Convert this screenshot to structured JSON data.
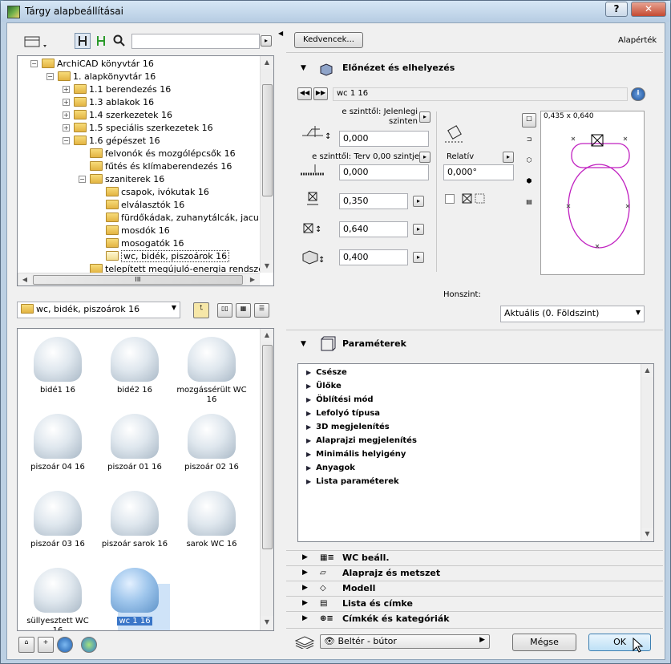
{
  "window": {
    "title": "Tárgy alapbeállításai",
    "help_label": "?",
    "close_label": "✕"
  },
  "tree": {
    "items": [
      {
        "label": "ArchiCAD könyvtár 16",
        "level": 0,
        "toggle": "−"
      },
      {
        "label": "1. alapkönyvtár 16",
        "level": 1,
        "toggle": "−"
      },
      {
        "label": "1.1 berendezés 16",
        "level": 2,
        "toggle": "+"
      },
      {
        "label": "1.3 ablakok 16",
        "level": 2,
        "toggle": "+"
      },
      {
        "label": "1.4 szerkezetek 16",
        "level": 2,
        "toggle": "+"
      },
      {
        "label": "1.5 speciális szerkezetek 16",
        "level": 2,
        "toggle": "+"
      },
      {
        "label": "1.6 gépészet 16",
        "level": 2,
        "toggle": "−"
      },
      {
        "label": "felvonók és mozgólépcsők 16",
        "level": 3,
        "toggle": ""
      },
      {
        "label": "fűtés és klímaberendezés 16",
        "level": 3,
        "toggle": ""
      },
      {
        "label": "szaniterek 16",
        "level": 3,
        "toggle": "−"
      },
      {
        "label": "csapok, ivókutak 16",
        "level": 4,
        "toggle": ""
      },
      {
        "label": "elválasztók 16",
        "level": 4,
        "toggle": ""
      },
      {
        "label": "fürdőkádak, zuhanytálcák, jacu",
        "level": 4,
        "toggle": ""
      },
      {
        "label": "mosdók 16",
        "level": 4,
        "toggle": ""
      },
      {
        "label": "mosogatók 16",
        "level": 4,
        "toggle": ""
      },
      {
        "label": "wc, bidék, piszoárok 16",
        "level": 4,
        "toggle": "",
        "selected": true
      },
      {
        "label": "telepített megújuló-energia rendsze",
        "level": 3,
        "toggle": ""
      }
    ],
    "hscroll_label": "III"
  },
  "folder_select": {
    "value": "wc, bidék, piszoárok 16"
  },
  "gallery": {
    "items": [
      {
        "label": "bidé1 16"
      },
      {
        "label": "bidé2 16"
      },
      {
        "label": "mozgássérült WC 16"
      },
      {
        "label": "piszoár  04 16"
      },
      {
        "label": "piszoár 01 16"
      },
      {
        "label": "piszoár 02 16"
      },
      {
        "label": "piszoár 03 16"
      },
      {
        "label": "piszoár sarok 16"
      },
      {
        "label": "sarok WC 16"
      },
      {
        "label": "süllyesztett WC 16"
      },
      {
        "label": "wc 1 16",
        "selected": true
      }
    ]
  },
  "top": {
    "favorites_label": "Kedvencek...",
    "defaults_label": "Alapérték"
  },
  "preview_section": {
    "title": "Előnézet és elhelyezés",
    "object_name": "wc 1 16",
    "level_label_1": "e szinttől: Jelenlegi szinten",
    "value_1": "0,000",
    "level_label_2": "e szinttől: Terv 0,00 szintje",
    "value_2": "0,000",
    "relative_label": "Relatív",
    "angle_value": "0,000°",
    "width_value": "0,350",
    "depth_value": "0,640",
    "height_value": "0,400",
    "size_readout": "0,435 x 0,640",
    "home_level_label": "Honszint:",
    "home_level_value": "Aktuális (0. Földszint)"
  },
  "params_section": {
    "title": "Paraméterek",
    "items": [
      "Csésze",
      "Ülőke",
      "Öblítési mód",
      "Lefolyó típusa",
      "3D megjelenítés",
      "Alaprajzi megjelenítés",
      "Minimális helyigény",
      "Anyagok",
      "Lista paraméterek"
    ]
  },
  "collapsed_sections": [
    "WC beáll.",
    "Alaprajz és metszet",
    "Modell",
    "Lista és címke",
    "Címkék és kategóriák"
  ],
  "bottom": {
    "layer_value": "Beltér - bútor",
    "cancel_label": "Mégse",
    "ok_label": "OK"
  },
  "colors": {
    "preview_outline": "#c020c0",
    "selection": "#3a76c8"
  }
}
